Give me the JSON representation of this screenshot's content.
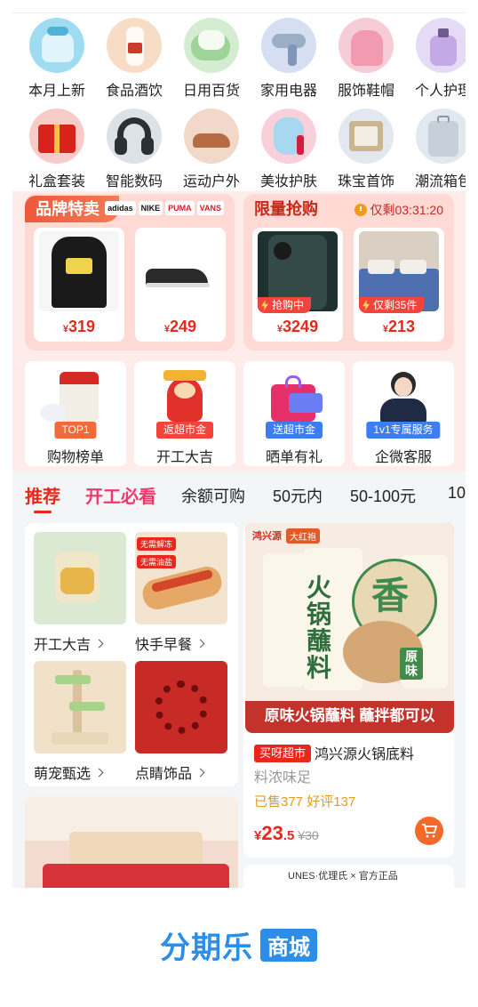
{
  "categories": [
    {
      "label": "本月上新",
      "icon": "new-arrivals-icon",
      "color": "#8fd3ee"
    },
    {
      "label": "食品酒饮",
      "icon": "liquor-bottle-icon",
      "color": "#f7d7bf"
    },
    {
      "label": "日用百货",
      "icon": "towel-roll-icon",
      "color": "#cfe8c9"
    },
    {
      "label": "家用电器",
      "icon": "hair-dryer-icon",
      "color": "#cfd8ef"
    },
    {
      "label": "服饰鞋帽",
      "icon": "hoodie-icon",
      "color": "#f4c6cf"
    },
    {
      "label": "个人护理",
      "icon": "perfume-icon",
      "color": "#e2d6f2"
    },
    {
      "label": "礼盒套装",
      "icon": "gift-box-icon",
      "color": "#f6c6c2"
    },
    {
      "label": "智能数码",
      "icon": "headphones-icon",
      "color": "#d6dbe4"
    },
    {
      "label": "运动户外",
      "icon": "sports-shoes-icon",
      "color": "#f0d3c3"
    },
    {
      "label": "美妆护肤",
      "icon": "face-mask-icon",
      "color": "#f7c9d4"
    },
    {
      "label": "珠宝首饰",
      "icon": "jewelry-box-icon",
      "color": "#dfe4ee"
    },
    {
      "label": "潮流箱包",
      "icon": "suitcase-icon",
      "color": "#dfe6ee"
    }
  ],
  "brand_sale": {
    "title": "品牌特卖",
    "brand_logos": [
      "adidas",
      "NIKE",
      "PUMA",
      "VANS"
    ],
    "items": [
      {
        "price_symbol": "¥",
        "price": "319",
        "icon": "black-hoodie-icon"
      },
      {
        "price_symbol": "¥",
        "price": "249",
        "icon": "running-shoe-icon"
      }
    ]
  },
  "flash_sale": {
    "title": "限量抢购",
    "countdown": "仅剩03:31:20",
    "items": [
      {
        "tag": "抢购中",
        "price_symbol": "¥",
        "price": "3249",
        "icon": "phone-icon"
      },
      {
        "tag": "仅剩35件",
        "price_symbol": "¥",
        "price": "213",
        "icon": "bedding-icon"
      }
    ]
  },
  "services": [
    {
      "badge": "TOP1",
      "label": "购物榜单",
      "badge_color": "#f06a3c",
      "icon": "rice-bag-icon"
    },
    {
      "badge": "返超市金",
      "label": "开工大吉",
      "badge_color": "#f2443a",
      "icon": "fortune-god-icon"
    },
    {
      "badge": "送超市金",
      "label": "晒单有礼",
      "badge_color": "#3d7df0",
      "icon": "gift-bag-icon"
    },
    {
      "badge": "1v1专属服务",
      "label": "企微客服",
      "badge_color": "#3d7df0",
      "icon": "customer-service-icon"
    }
  ],
  "tabs": [
    "推荐",
    "开工必看",
    "余额可购",
    "50元内",
    "50-100元",
    "10"
  ],
  "feature_grid": [
    {
      "label": "开工大吉",
      "icon": "kettle-icon"
    },
    {
      "label": "快手早餐",
      "icon": "breakfast-wrap-icon"
    },
    {
      "label": "萌宠甄选",
      "icon": "cat-tree-icon"
    },
    {
      "label": "点睛饰品",
      "icon": "bracelet-icon"
    }
  ],
  "breakfast_tags": [
    "无需解冻",
    "无需油盐"
  ],
  "product": {
    "brand_top_left": "鸿兴源",
    "brand_top_tag": "大红袍",
    "package_title": "火锅蘸料",
    "package_side_text": "原味",
    "package_circle": "香",
    "banner_text": "原味火锅蘸料 蘸拌都可以",
    "chip": "买呀超市",
    "name": "鸿兴源火锅底料",
    "subtitle": "料浓味足",
    "stats": "已售377 好评137",
    "price_symbol": "¥",
    "price_int": "23",
    "price_dec": ".5",
    "old_price": "¥30"
  },
  "next_product_caption": "UNES·优理氏 × 官方正品",
  "footer_logo": {
    "main": "分期乐",
    "box": "商城"
  },
  "colors": {
    "accent": "#e8281d",
    "brand_blue": "#2d8ee8",
    "hot_tab": "#f0386b"
  }
}
